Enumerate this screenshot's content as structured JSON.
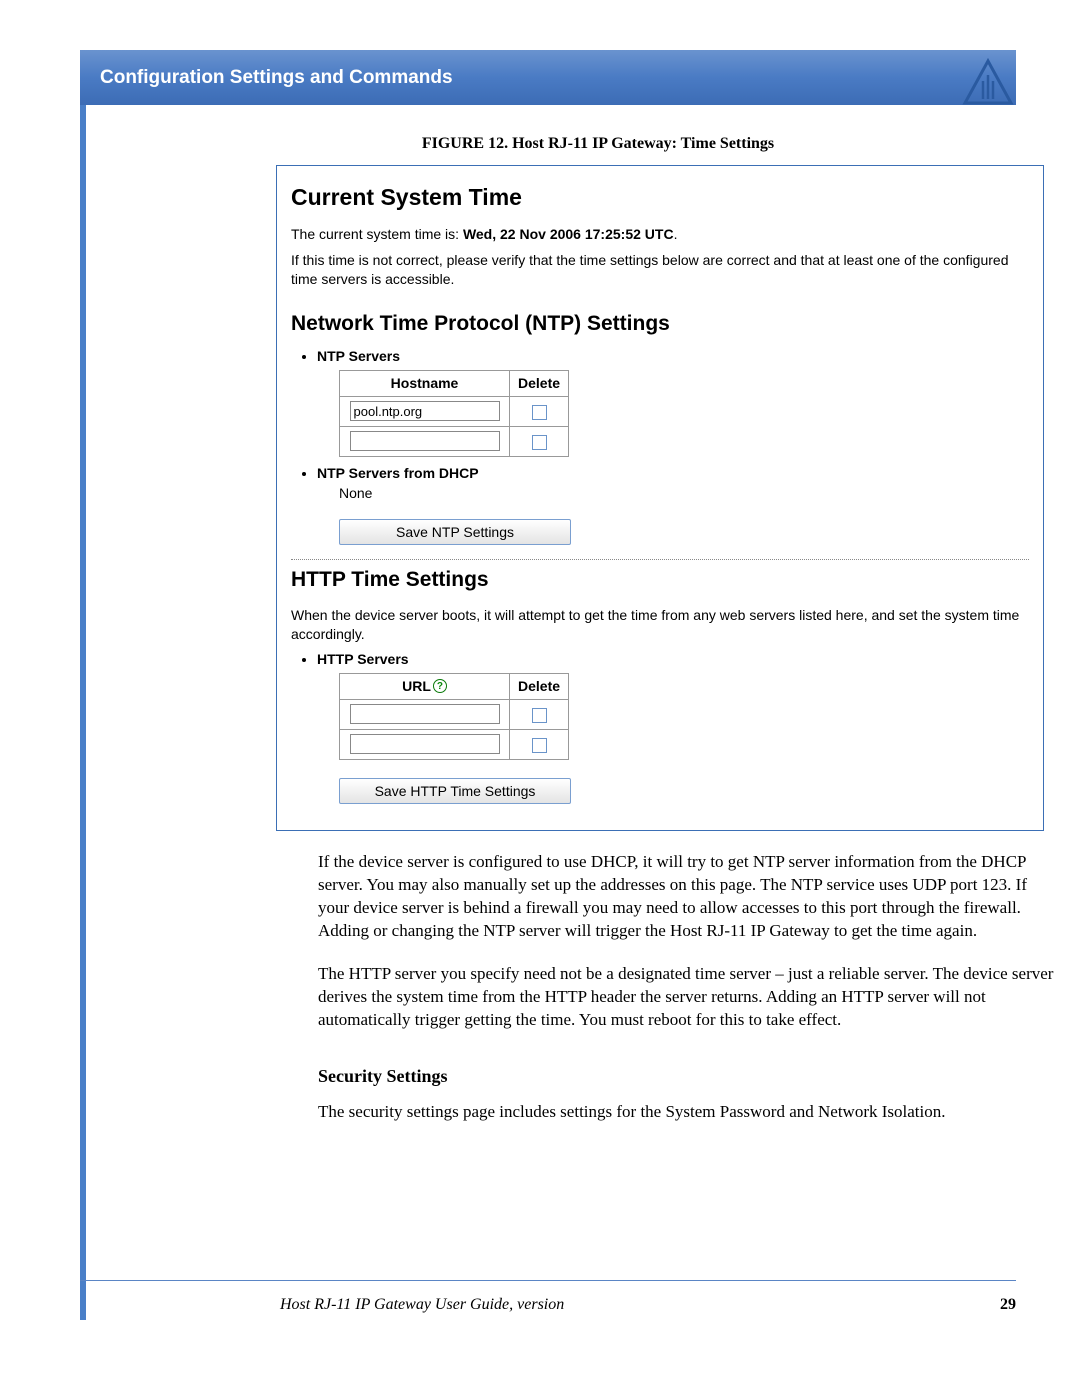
{
  "header": {
    "title": "Configuration Settings and Commands"
  },
  "figure": {
    "label": "FIGURE 12.",
    "caption": "Host RJ-11 IP Gateway: Time Settings"
  },
  "screenshot": {
    "currentTime": {
      "heading": "Current System Time",
      "prefix": "The current system time is: ",
      "value": "Wed, 22 Nov 2006 17:25:52 UTC",
      "suffix": ".",
      "note": "If this time is not correct, please verify that the time settings below are correct and that at least one of the configured time servers is accessible."
    },
    "ntp": {
      "heading": "Network Time Protocol (NTP) Settings",
      "listLabel": "NTP Servers",
      "cols": {
        "host": "Hostname",
        "del": "Delete"
      },
      "rows": [
        {
          "host": "pool.ntp.org"
        },
        {
          "host": ""
        }
      ],
      "dhcpLabel": "NTP Servers from DHCP",
      "dhcpValue": "None",
      "saveBtn": "Save NTP Settings"
    },
    "http": {
      "heading": "HTTP Time Settings",
      "note": "When the device server boots, it will attempt to get the time from any web servers listed here, and set the system time accordingly.",
      "listLabel": "HTTP Servers",
      "cols": {
        "url": "URL",
        "del": "Delete"
      },
      "rows": [
        {
          "url": ""
        },
        {
          "url": ""
        }
      ],
      "saveBtn": "Save HTTP Time Settings"
    }
  },
  "paragraphs": {
    "p1": "If the device server is configured to use DHCP, it will try to get NTP server information from the DHCP server. You may also manually set up the addresses on this page. The NTP service uses UDP port 123. If your device server is behind a firewall you may need to allow accesses to this port through the firewall. Adding or changing the NTP server will trigger the Host RJ-11 IP Gateway to get the time again.",
    "p2": "The HTTP server you specify need not be a designated time server – just a reliable server. The device server derives the system time from the HTTP header the server returns. Adding an HTTP server will not automatically trigger getting the time. You must reboot for this to take effect."
  },
  "security": {
    "heading": "Security Settings",
    "text": "The security settings page includes settings for the System Password and Network Isolation."
  },
  "footer": {
    "text": "Host RJ-11 IP Gateway User Guide, version",
    "page": "29"
  }
}
